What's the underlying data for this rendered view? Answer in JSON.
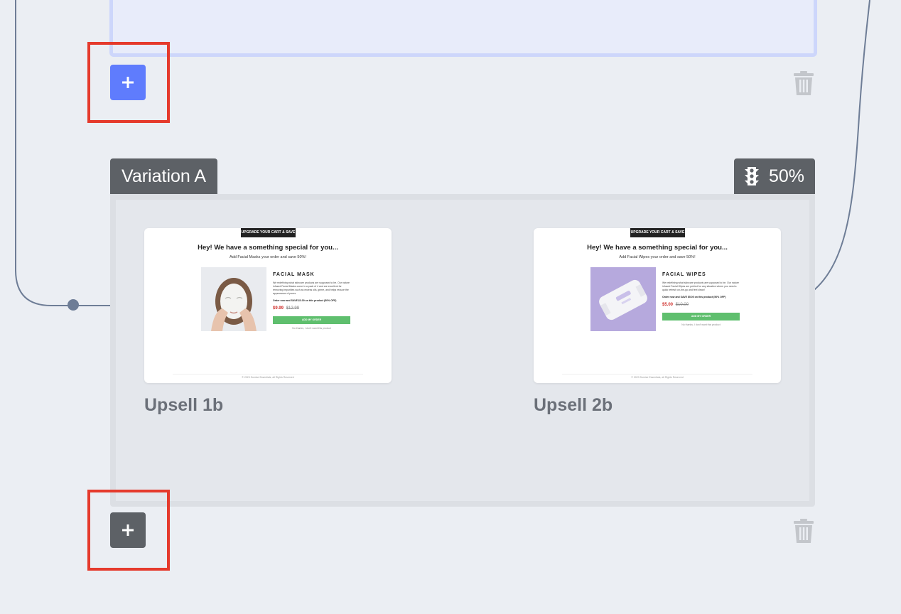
{
  "variation": {
    "name": "Variation A",
    "split_percent": "50%"
  },
  "steps": [
    {
      "label": "Upsell 1b",
      "preview": {
        "banner": "UPGRADE YOUR CART & SAVE",
        "headline": "Hey! We have a something special for you...",
        "subheadline": "Add Facial Masks your order and save 50%!",
        "product_title": "FACIAL MASK",
        "description": "We redefining what skincare products are supposed to be. Our nature infused Facial Masks come in a pack of 4 and are excellent for removing impurities such as excess oils, grime, and helps reduce the appearance of pores.",
        "offer": "Order now and SAVE $3.00 on this product (50% OFF)",
        "price_now": "$9.99",
        "price_was": "$12.99",
        "button": "ADD MY ORDER",
        "decline": "No thanks, I don't want this product",
        "footer": "© 2023 Sunrise Essentials, all Rights Reserved"
      }
    },
    {
      "label": "Upsell 2b",
      "preview": {
        "banner": "UPGRADE YOUR CART & SAVE",
        "headline": "Hey! We have a something special for you...",
        "subheadline": "Add Facial Wipes your order and save 50%!",
        "product_title": "FACIAL WIPES",
        "description": "We redefining what skincare products are supposed to be. Our nature infused Facial Wipes are perfect for any situation where you need a quick refresh on-the-go and feel clean!",
        "offer": "Order now and SAVE $5.00 on this product (50% OFF)",
        "price_now": "$5.00",
        "price_was": "$10.00",
        "button": "ADD MY ORDER",
        "decline": "No thanks, I don't want this product",
        "footer": "© 2023 Sunrise Essentials, all Rights Reserved"
      }
    }
  ],
  "icons": {
    "add": "plus-icon",
    "delete": "trash-icon",
    "split": "traffic-light-icon"
  },
  "colors": {
    "accent_blue": "#5f7cfd",
    "dark_button": "#5d6166",
    "highlight_red": "#e53a2c",
    "price_red": "#d0312d",
    "cta_green": "#5fbf6e",
    "connector": "#6e7d96"
  }
}
